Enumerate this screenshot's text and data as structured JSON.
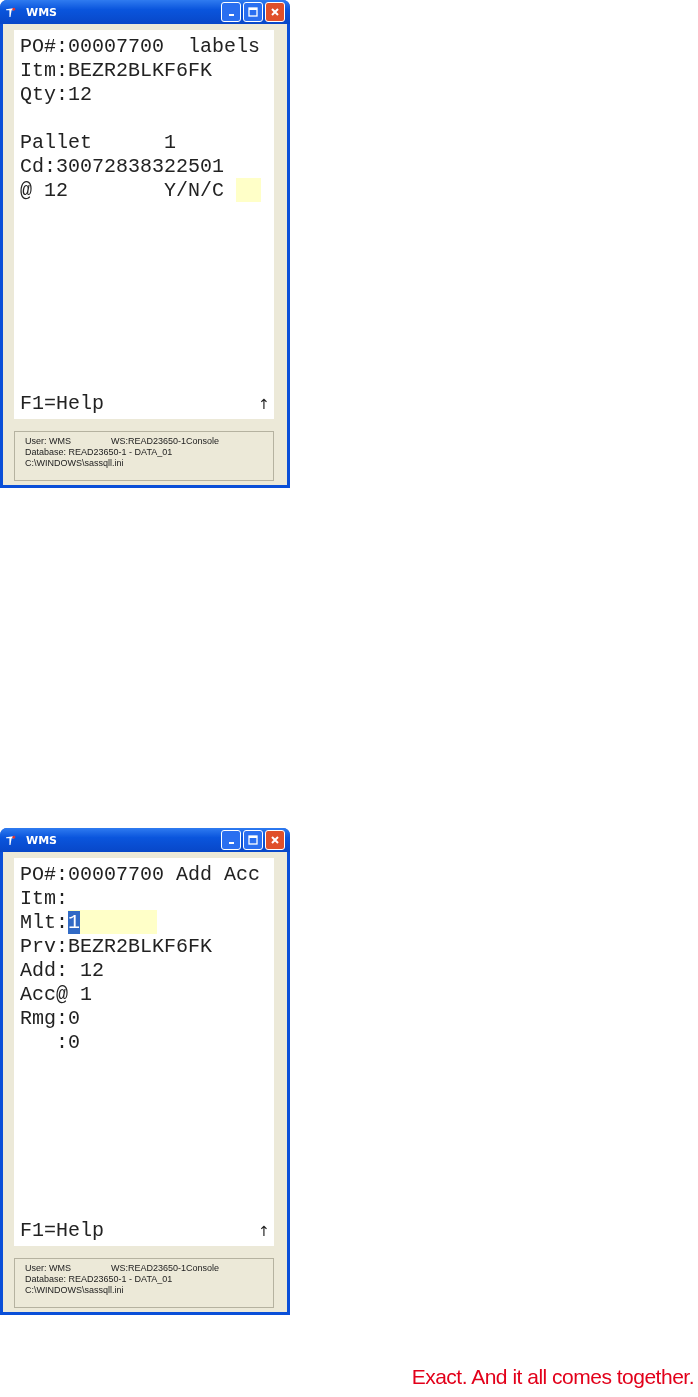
{
  "windows": [
    {
      "title": "WMS",
      "lines": [
        {
          "kind": "text",
          "text": "PO#:00007700  labels"
        },
        {
          "kind": "text",
          "text": "Itm:BEZR2BLKF6FK"
        },
        {
          "kind": "text",
          "text": "Qty:12"
        },
        {
          "kind": "blank"
        },
        {
          "kind": "text",
          "text": "Pallet      1"
        },
        {
          "kind": "text",
          "text": "Cd:30072838322501"
        },
        {
          "kind": "prompt",
          "label": "@ 12        Y/N/C "
        }
      ],
      "help": "F1=Help",
      "scroll_mark": "↑",
      "status": [
        "User: WMS",
        "WS:READ23650-1Console",
        "Database: READ23650-1 - DATA_01",
        "C:\\WINDOWS\\sassqll.ini"
      ]
    },
    {
      "title": "WMS",
      "lines": [
        {
          "kind": "text",
          "text": "PO#:00007700 Add Acc"
        },
        {
          "kind": "text",
          "text": "Itm:"
        },
        {
          "kind": "prompt",
          "label": "Mlt:",
          "value": "1",
          "selected": true
        },
        {
          "kind": "text",
          "text": "Prv:BEZR2BLKF6FK"
        },
        {
          "kind": "text",
          "text": "Add: 12"
        },
        {
          "kind": "text",
          "text": "Acc@ 1"
        },
        {
          "kind": "text",
          "text": "Rmg:0"
        },
        {
          "kind": "text",
          "text": "   :0"
        }
      ],
      "help": "F1=Help",
      "scroll_mark": "↑",
      "status": [
        "User: WMS",
        "WS:READ23650-1Console",
        "Database: READ23650-1 - DATA_01",
        "C:\\WINDOWS\\sassqll.ini"
      ]
    }
  ],
  "tagline": "Exact. And it all comes together."
}
